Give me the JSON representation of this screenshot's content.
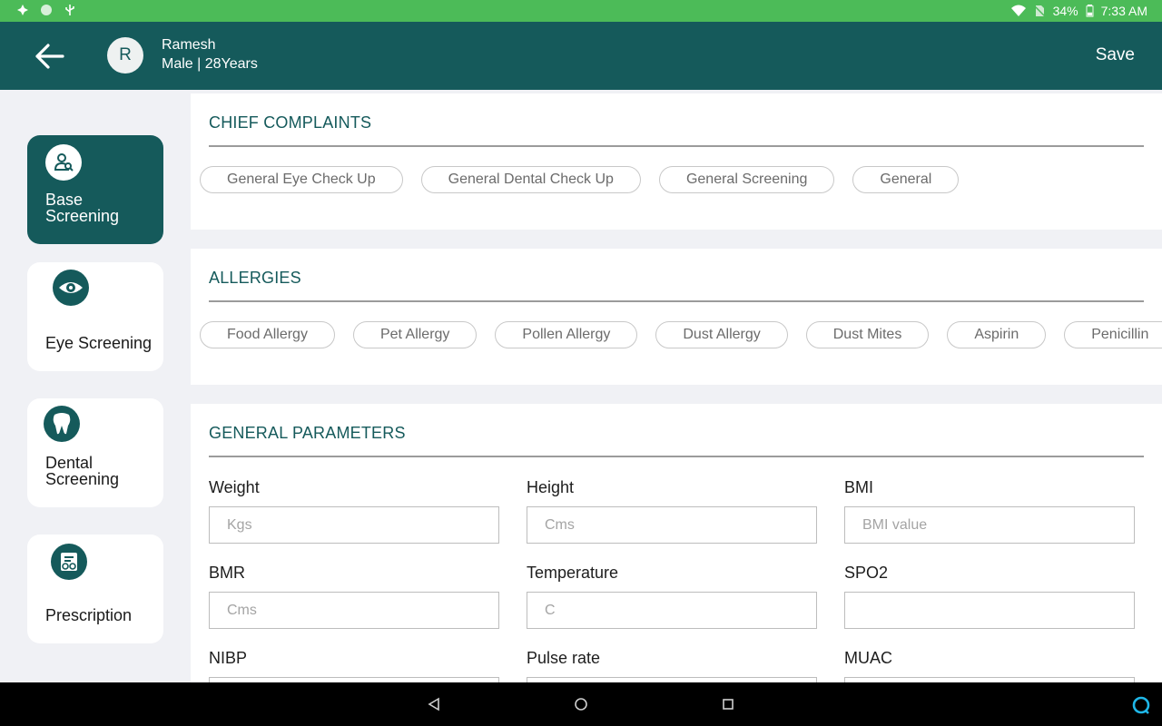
{
  "status_bar": {
    "battery": "34%",
    "time": "7:33 AM"
  },
  "header": {
    "avatar_initial": "R",
    "patient_name": "Ramesh",
    "patient_meta": "Male | 28Years",
    "save_label": "Save"
  },
  "sidebar": {
    "items": [
      {
        "label": "Base Screening",
        "icon": "screening-icon",
        "active": true
      },
      {
        "label": "Eye Screening",
        "icon": "eye-icon",
        "active": false
      },
      {
        "label": "Dental Screening",
        "icon": "tooth-icon",
        "active": false
      },
      {
        "label": "Prescription",
        "icon": "prescription-icon",
        "active": false
      }
    ]
  },
  "chief_complaints": {
    "title": "CHIEF COMPLAINTS",
    "chips": [
      "General Eye Check Up",
      "General Dental Check Up",
      "General Screening",
      "General"
    ]
  },
  "allergies": {
    "title": "ALLERGIES",
    "chips": [
      "Food Allergy",
      "Pet Allergy",
      "Pollen Allergy",
      "Dust Allergy",
      "Dust Mites",
      "Aspirin",
      "Penicillin"
    ]
  },
  "general_parameters": {
    "title": "GENERAL PARAMETERS",
    "fields": [
      {
        "label": "Weight",
        "placeholder": "Kgs"
      },
      {
        "label": "Height",
        "placeholder": "Cms"
      },
      {
        "label": "BMI",
        "placeholder": "BMI value"
      },
      {
        "label": "BMR",
        "placeholder": "Cms"
      },
      {
        "label": "Temperature",
        "placeholder": "C"
      },
      {
        "label": "SPO2",
        "placeholder": ""
      },
      {
        "label": "NIBP",
        "placeholder": ""
      },
      {
        "label": "Pulse rate",
        "placeholder": ""
      },
      {
        "label": "MUAC",
        "placeholder": ""
      }
    ]
  },
  "colors": {
    "status_bar": "#4cbb58",
    "primary": "#155a5b",
    "background": "#f0f1f5"
  }
}
